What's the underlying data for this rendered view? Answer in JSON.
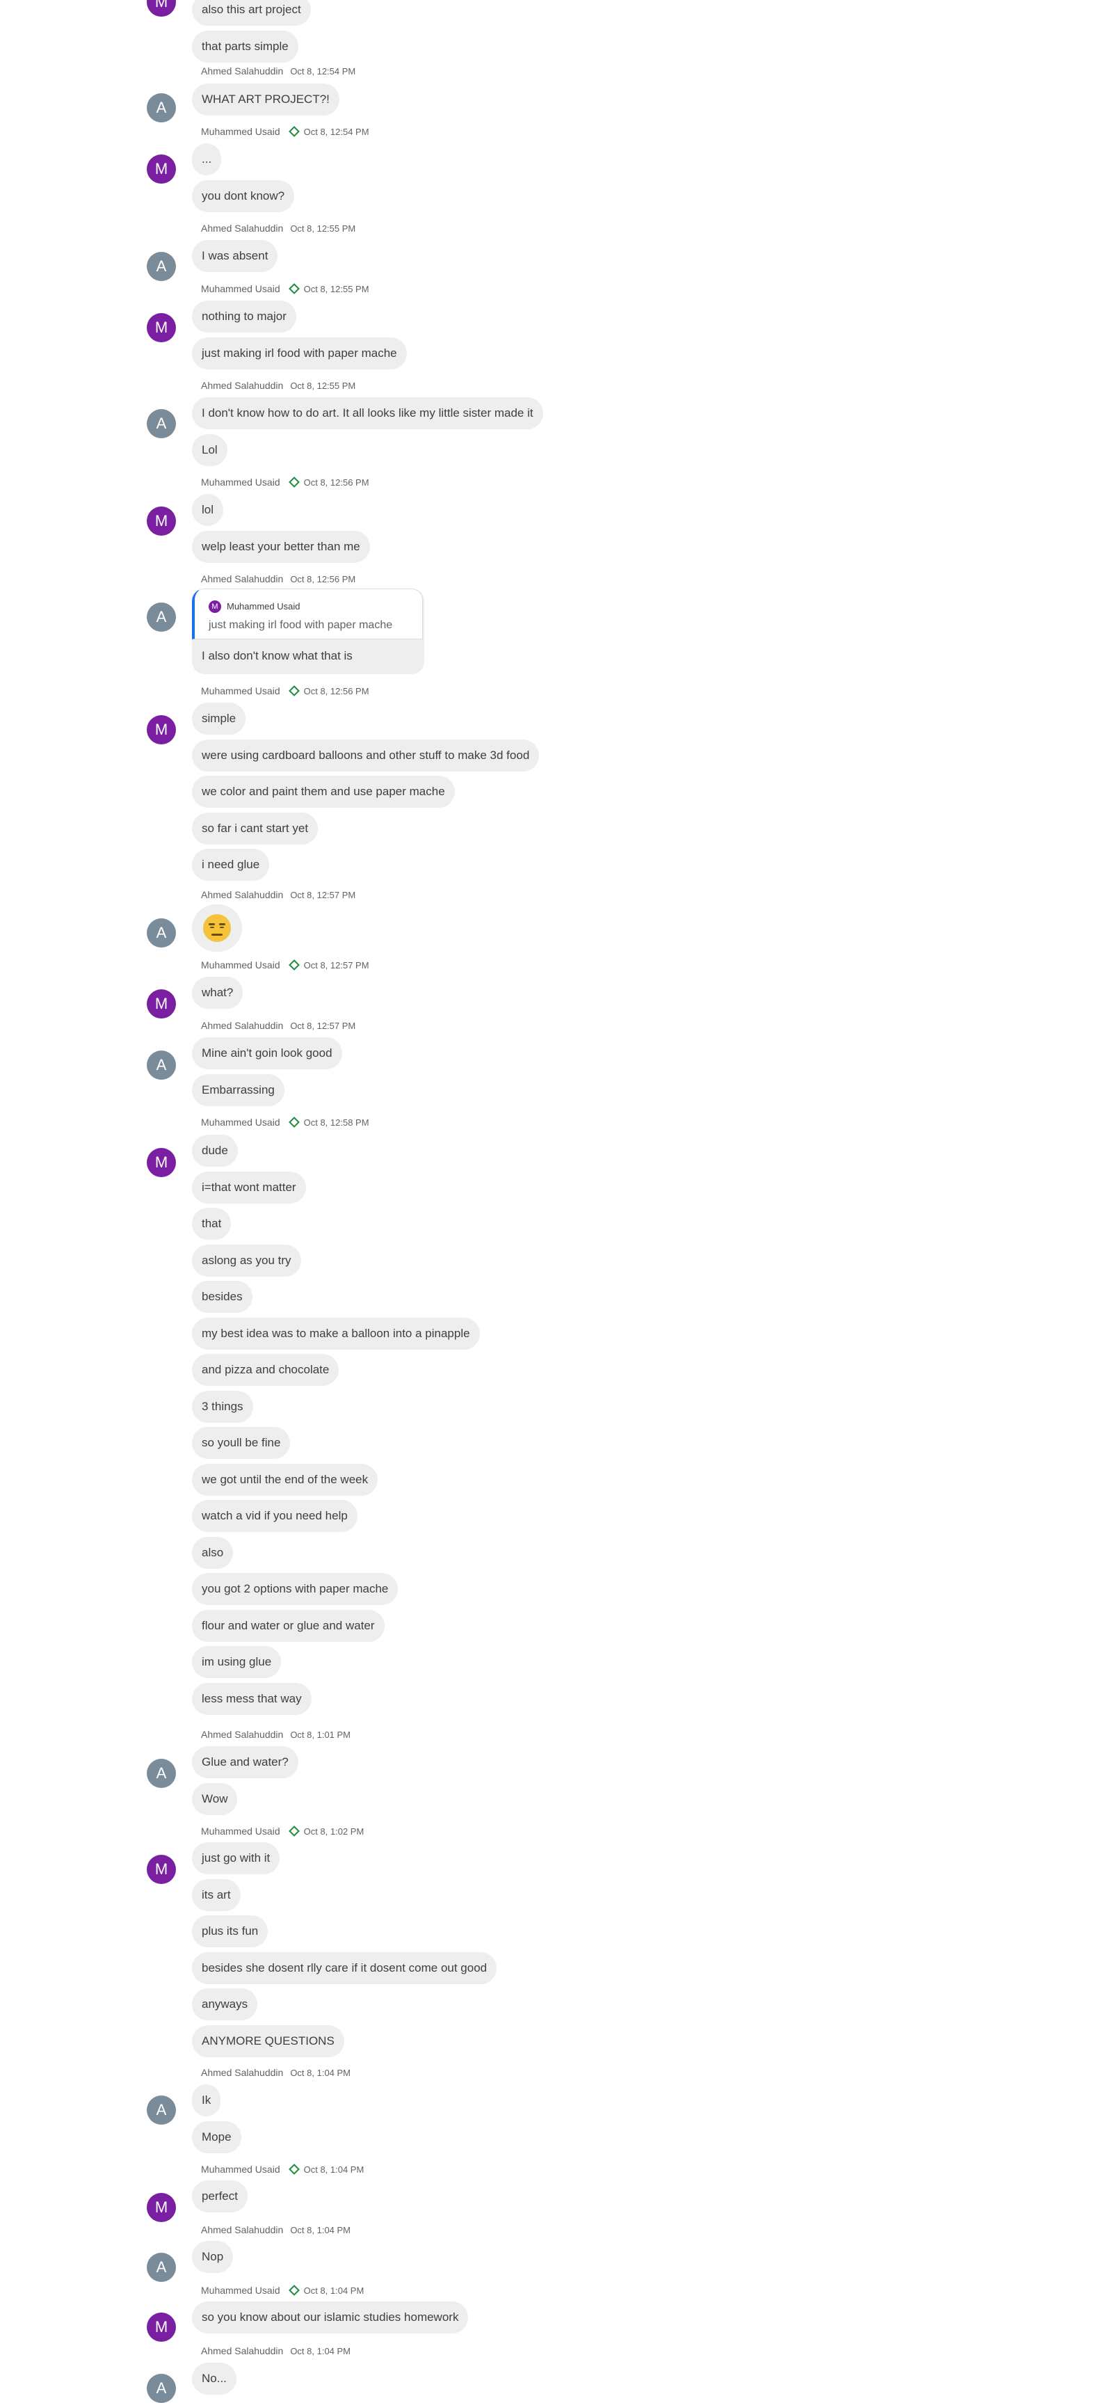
{
  "users": {
    "m": {
      "name": "Muhammed Usaid",
      "initial": "M",
      "color": "#7b1fa2"
    },
    "a": {
      "name": "Ahmed Salahuddin",
      "initial": "A",
      "color": "#7a8b99"
    }
  },
  "icons": {
    "verified": "diamond-outline-icon",
    "verified_color": "#1e8e3e"
  },
  "reply": {
    "quoted_author": "Muhammed Usaid",
    "quoted_text": "just making irl food with paper mache",
    "text": "I also don't know what that is"
  },
  "emoji_message": "😑",
  "groups": [
    {
      "sender": "m",
      "time": "",
      "messages": [
        "also this art project",
        "that parts simple"
      ]
    },
    {
      "sender": "a",
      "time": "Oct 8, 12:54 PM",
      "messages": [
        "WHAT ART PROJECT?!"
      ]
    },
    {
      "sender": "m",
      "time": "Oct 8, 12:54 PM",
      "messages": [
        "...",
        "you dont know?"
      ]
    },
    {
      "sender": "a",
      "time": "Oct 8, 12:55 PM",
      "messages": [
        "I was absent"
      ]
    },
    {
      "sender": "m",
      "time": "Oct 8, 12:55 PM",
      "messages": [
        "nothing to major",
        "just making irl food with paper mache"
      ]
    },
    {
      "sender": "a",
      "time": "Oct 8, 12:55 PM",
      "messages": [
        "I don't know how to do art. It all looks like my little sister made it",
        "Lol"
      ]
    },
    {
      "sender": "m",
      "time": "Oct 8, 12:56 PM",
      "messages": [
        "lol",
        "welp least your better than me"
      ]
    },
    {
      "sender": "a",
      "time": "Oct 8, 12:56 PM",
      "messages": []
    },
    {
      "sender": "m",
      "time": "Oct 8, 12:56 PM",
      "messages": [
        "simple",
        "were using cardboard balloons and other stuff to make 3d food",
        "we color and paint them and use paper mache",
        "so far i cant start yet",
        "i need glue"
      ]
    },
    {
      "sender": "a",
      "time": "Oct 8, 12:57 PM",
      "messages": []
    },
    {
      "sender": "m",
      "time": "Oct 8, 12:57 PM",
      "messages": [
        "what?"
      ]
    },
    {
      "sender": "a",
      "time": "Oct 8, 12:57 PM",
      "messages": [
        "Mine ain't goin look good",
        "Embarrassing"
      ]
    },
    {
      "sender": "m",
      "time": "Oct 8, 12:58 PM",
      "messages": [
        "dude",
        "i=that wont matter",
        "that",
        "aslong as you try",
        "besides",
        "my best idea was to make a balloon into a pinapple",
        "and pizza and chocolate",
        "3 things",
        "so youll be fine",
        "we got until the end of the week",
        "watch a vid if you need help",
        "also",
        "you got 2 options with paper mache",
        "flour and water or glue and water",
        "im using glue",
        "less mess that way"
      ]
    },
    {
      "sender": "a",
      "time": "Oct 8, 1:01 PM",
      "messages": [
        "Glue and water?",
        "Wow"
      ]
    },
    {
      "sender": "m",
      "time": "Oct 8, 1:02 PM",
      "messages": [
        "just go with it",
        "its art",
        "plus its fun",
        "besides she dosent rlly care if it dosent come out good",
        "anyways",
        "ANYMORE QUESTIONS"
      ]
    },
    {
      "sender": "a",
      "time": "Oct 8, 1:04 PM",
      "messages": [
        "Ik",
        "Mope"
      ]
    },
    {
      "sender": "m",
      "time": "Oct 8, 1:04 PM",
      "messages": [
        "perfect"
      ]
    },
    {
      "sender": "a",
      "time": "Oct 8, 1:04 PM",
      "messages": [
        "Nop"
      ]
    },
    {
      "sender": "m",
      "time": "Oct 8, 1:04 PM",
      "messages": [
        "so you know about our islamic studies homework"
      ]
    },
    {
      "sender": "a",
      "time": "Oct 8, 1:04 PM",
      "messages": [
        "No..."
      ]
    }
  ]
}
